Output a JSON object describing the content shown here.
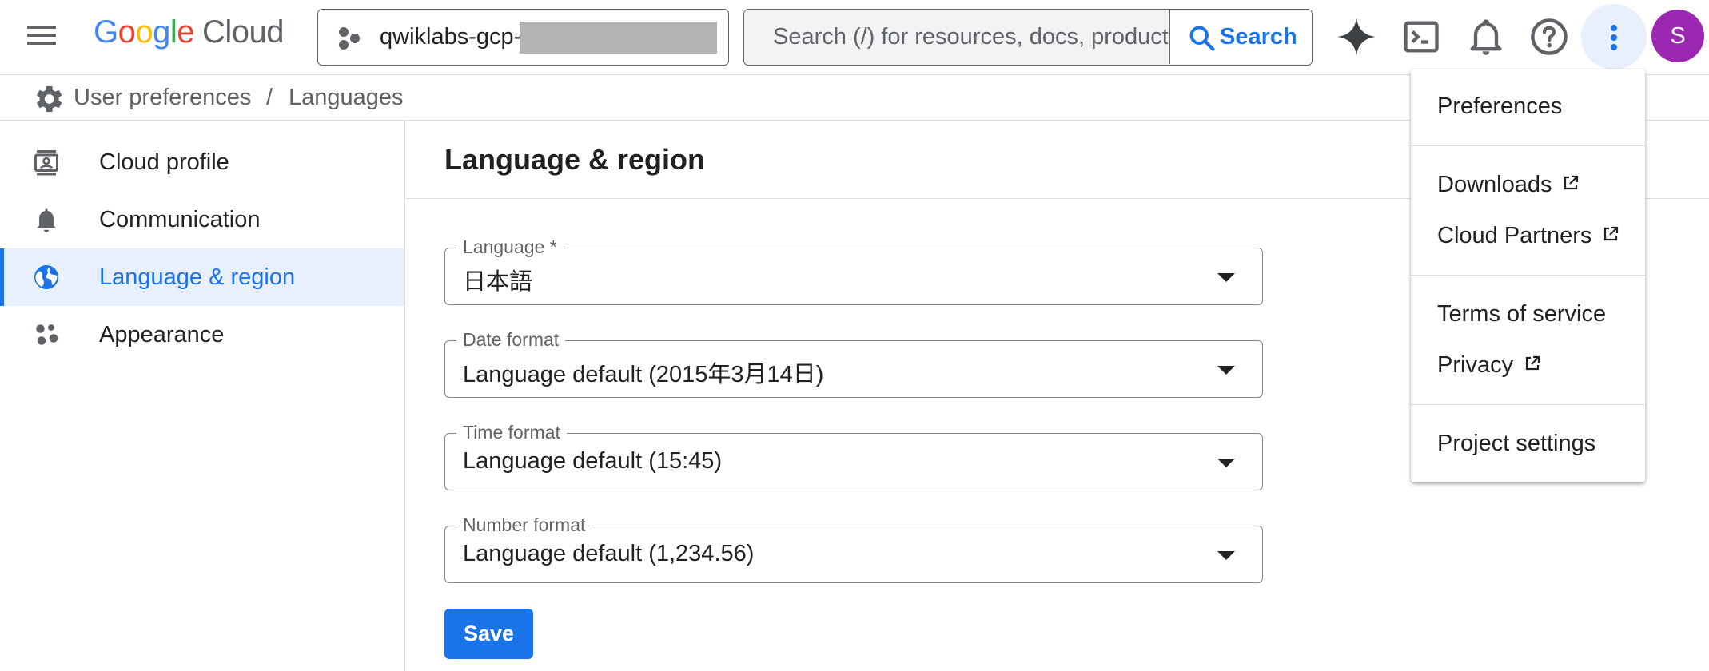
{
  "topbar": {
    "logo": {
      "G": "G",
      "o1": "o",
      "o2": "o",
      "g": "g",
      "l": "l",
      "e": "e",
      "cloud": "Cloud"
    },
    "project": "qwiklabs-gcp-",
    "search_placeholder": "Search (/) for resources, docs, product...",
    "search_button": "Search",
    "avatar_letter": "S"
  },
  "breadcrumb": {
    "parent": "User preferences",
    "separator": "/",
    "current": "Languages"
  },
  "sidebar": {
    "items": [
      {
        "label": "Cloud profile",
        "icon": "profile-icon"
      },
      {
        "label": "Communication",
        "icon": "bell-icon"
      },
      {
        "label": "Language & region",
        "icon": "globe-icon",
        "active": true
      },
      {
        "label": "Appearance",
        "icon": "palette-icon"
      }
    ]
  },
  "main": {
    "title": "Language & region",
    "fields": [
      {
        "label": "Language *",
        "value": "日本語"
      },
      {
        "label": "Date format",
        "value": "Language default (2015年3月14日)"
      },
      {
        "label": "Time format",
        "value": "Language default (15:45)"
      },
      {
        "label": "Number format",
        "value": "Language default (1,234.56)"
      }
    ],
    "save_label": "Save"
  },
  "menu": {
    "items": [
      {
        "label": "Preferences"
      },
      {
        "label": "Downloads",
        "external": true
      },
      {
        "label": "Cloud Partners",
        "external": true
      },
      {
        "label": "Terms of service"
      },
      {
        "label": "Privacy",
        "external": true
      },
      {
        "label": "Project settings"
      }
    ]
  },
  "colors": {
    "accent": "#1a73e8",
    "active_bg": "#e8f0fe",
    "avatar": "#9c27b0",
    "border": "#dadce0"
  }
}
